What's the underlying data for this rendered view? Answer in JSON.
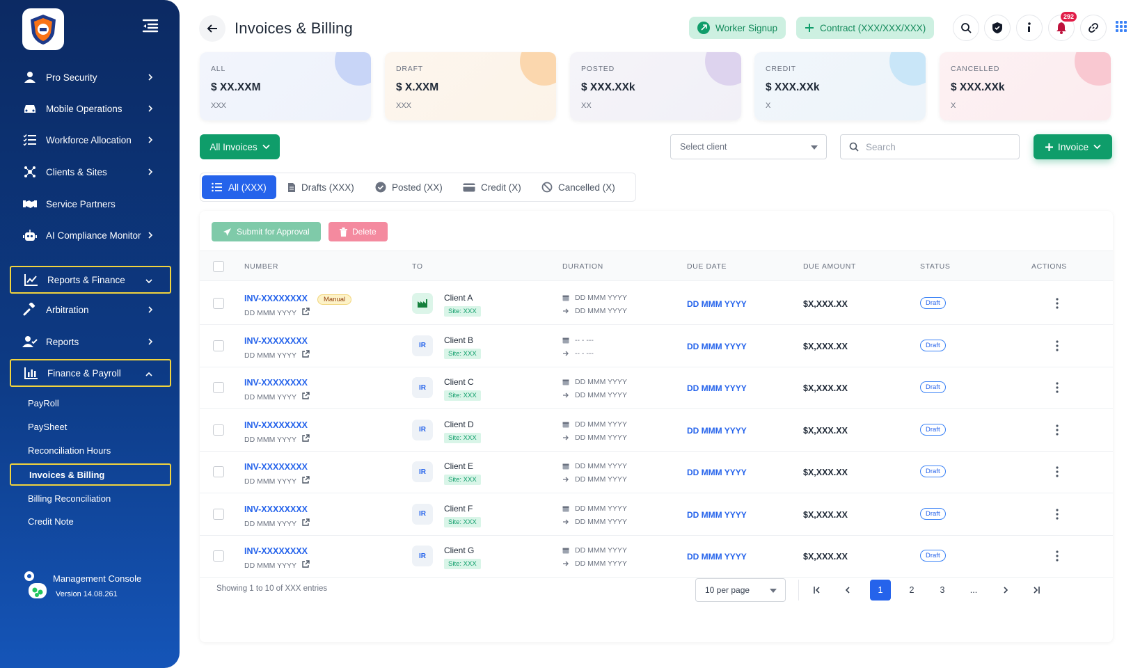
{
  "sidebar": {
    "items": [
      {
        "label": "Pro Security"
      },
      {
        "label": "Mobile Operations"
      },
      {
        "label": "Workforce Allocation"
      },
      {
        "label": "Clients & Sites"
      },
      {
        "label": "Service Partners"
      },
      {
        "label": "AI Compliance Monitor"
      },
      {
        "label": "Reports & Finance"
      },
      {
        "label": "Arbitration"
      },
      {
        "label": "Reports"
      },
      {
        "label": "Finance & Payroll"
      }
    ],
    "sub_items": [
      {
        "label": "PayRoll"
      },
      {
        "label": "PaySheet"
      },
      {
        "label": "Reconciliation Hours"
      },
      {
        "label": "Invoices & Billing"
      },
      {
        "label": "Billing Reconciliation"
      },
      {
        "label": "Credit Note"
      }
    ],
    "footer": {
      "title": "Management Console",
      "version": "Version 14.08.261"
    }
  },
  "header": {
    "title": "Invoices & Billing",
    "worker_signup": "Worker Signup",
    "contract": "Contract (XXX/XXX/XXX)",
    "notification_count": "292"
  },
  "stats": [
    {
      "label": "ALL",
      "value": "$ XX.XXM",
      "sub": "XXX"
    },
    {
      "label": "DRAFT",
      "value": "$ X.XXM",
      "sub": "XXX"
    },
    {
      "label": "POSTED",
      "value": "$ XXX.XXk",
      "sub": "XX"
    },
    {
      "label": "CREDIT",
      "value": "$ XXX.XXk",
      "sub": "X"
    },
    {
      "label": "CANCELLED",
      "value": "$ XXX.XXk",
      "sub": "X"
    }
  ],
  "filters": {
    "all_invoices": "All Invoices",
    "select_client": "Select client",
    "search_placeholder": "Search",
    "add_invoice": "Invoice"
  },
  "tabs": [
    {
      "label": "All (XXX)"
    },
    {
      "label": "Drafts (XXX)"
    },
    {
      "label": "Posted (XX)"
    },
    {
      "label": "Credit (X)"
    },
    {
      "label": "Cancelled (X)"
    }
  ],
  "actions": {
    "submit": "Submit for Approval",
    "delete": "Delete"
  },
  "table": {
    "headers": [
      "NUMBER",
      "TO",
      "DURATION",
      "DUE DATE",
      "DUE AMOUNT",
      "STATUS",
      "ACTIONS"
    ],
    "manual_badge": "Manual",
    "rows": [
      {
        "number": "INV-XXXXXXXX",
        "date": "DD MMM YYYY",
        "avatar": "",
        "client": "Client A",
        "site": "Site: XXX",
        "start": "DD MMM YYYY",
        "end": "DD MMM YYYY",
        "due": "DD MMM YYYY",
        "amount": "$X,XXX.XX",
        "status": "Draft"
      },
      {
        "number": "INV-XXXXXXXX",
        "date": "DD MMM YYYY",
        "avatar": "IR",
        "client": "Client B",
        "site": "Site: XXX",
        "start": "-- - ---",
        "end": "-- - ---",
        "due": "DD MMM YYYY",
        "amount": "$X,XXX.XX",
        "status": "Draft"
      },
      {
        "number": "INV-XXXXXXXX",
        "date": "DD MMM YYYY",
        "avatar": "IR",
        "client": "Client C",
        "site": "Site: XXX",
        "start": "DD MMM YYYY",
        "end": "DD MMM YYYY",
        "due": "DD MMM YYYY",
        "amount": "$X,XXX.XX",
        "status": "Draft"
      },
      {
        "number": "INV-XXXXXXXX",
        "date": "DD MMM YYYY",
        "avatar": "IR",
        "client": "Client D",
        "site": "Site: XXX",
        "start": "DD MMM YYYY",
        "end": "DD MMM YYYY",
        "due": "DD MMM YYYY",
        "amount": "$X,XXX.XX",
        "status": "Draft"
      },
      {
        "number": "INV-XXXXXXXX",
        "date": "DD MMM YYYY",
        "avatar": "IR",
        "client": "Client E",
        "site": "Site: XXX",
        "start": "DD MMM YYYY",
        "end": "DD MMM YYYY",
        "due": "DD MMM YYYY",
        "amount": "$X,XXX.XX",
        "status": "Draft"
      },
      {
        "number": "INV-XXXXXXXX",
        "date": "DD MMM YYYY",
        "avatar": "IR",
        "client": "Client F",
        "site": "Site: XXX",
        "start": "DD MMM YYYY",
        "end": "DD MMM YYYY",
        "due": "DD MMM YYYY",
        "amount": "$X,XXX.XX",
        "status": "Draft"
      },
      {
        "number": "INV-XXXXXXXX",
        "date": "DD MMM YYYY",
        "avatar": "IR",
        "client": "Client G",
        "site": "Site: XXX",
        "start": "DD MMM YYYY",
        "end": "DD MMM YYYY",
        "due": "DD MMM YYYY",
        "amount": "$X,XXX.XX",
        "status": "Draft"
      }
    ]
  },
  "footer": {
    "info": "Showing 1 to 10 of XXX entries",
    "per_page": "10 per page",
    "pages": [
      "1",
      "2",
      "3",
      "..."
    ]
  },
  "colors": {
    "accent": "#0f9d6a",
    "primary": "#2563eb",
    "sidebar": "#0d3a84",
    "highlight": "#f2d43d"
  }
}
